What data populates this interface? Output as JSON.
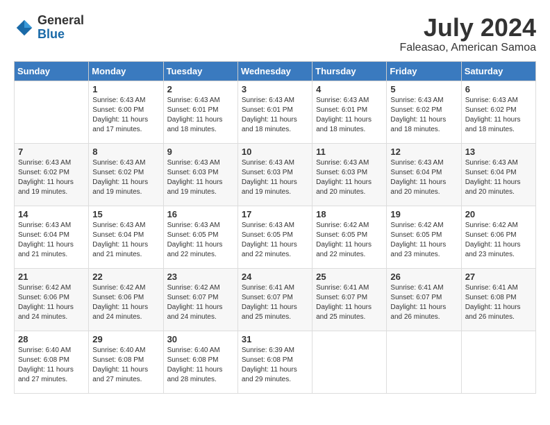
{
  "logo": {
    "general": "General",
    "blue": "Blue",
    "icon_color": "#1a6aa8"
  },
  "title": {
    "month_year": "July 2024",
    "location": "Faleasao, American Samoa"
  },
  "weekdays": [
    "Sunday",
    "Monday",
    "Tuesday",
    "Wednesday",
    "Thursday",
    "Friday",
    "Saturday"
  ],
  "weeks": [
    [
      {
        "day": "",
        "sunrise": "",
        "sunset": "",
        "daylight": ""
      },
      {
        "day": "1",
        "sunrise": "Sunrise: 6:43 AM",
        "sunset": "Sunset: 6:00 PM",
        "daylight": "Daylight: 11 hours and 17 minutes."
      },
      {
        "day": "2",
        "sunrise": "Sunrise: 6:43 AM",
        "sunset": "Sunset: 6:01 PM",
        "daylight": "Daylight: 11 hours and 18 minutes."
      },
      {
        "day": "3",
        "sunrise": "Sunrise: 6:43 AM",
        "sunset": "Sunset: 6:01 PM",
        "daylight": "Daylight: 11 hours and 18 minutes."
      },
      {
        "day": "4",
        "sunrise": "Sunrise: 6:43 AM",
        "sunset": "Sunset: 6:01 PM",
        "daylight": "Daylight: 11 hours and 18 minutes."
      },
      {
        "day": "5",
        "sunrise": "Sunrise: 6:43 AM",
        "sunset": "Sunset: 6:02 PM",
        "daylight": "Daylight: 11 hours and 18 minutes."
      },
      {
        "day": "6",
        "sunrise": "Sunrise: 6:43 AM",
        "sunset": "Sunset: 6:02 PM",
        "daylight": "Daylight: 11 hours and 18 minutes."
      }
    ],
    [
      {
        "day": "7",
        "sunrise": "Sunrise: 6:43 AM",
        "sunset": "Sunset: 6:02 PM",
        "daylight": "Daylight: 11 hours and 19 minutes."
      },
      {
        "day": "8",
        "sunrise": "Sunrise: 6:43 AM",
        "sunset": "Sunset: 6:02 PM",
        "daylight": "Daylight: 11 hours and 19 minutes."
      },
      {
        "day": "9",
        "sunrise": "Sunrise: 6:43 AM",
        "sunset": "Sunset: 6:03 PM",
        "daylight": "Daylight: 11 hours and 19 minutes."
      },
      {
        "day": "10",
        "sunrise": "Sunrise: 6:43 AM",
        "sunset": "Sunset: 6:03 PM",
        "daylight": "Daylight: 11 hours and 19 minutes."
      },
      {
        "day": "11",
        "sunrise": "Sunrise: 6:43 AM",
        "sunset": "Sunset: 6:03 PM",
        "daylight": "Daylight: 11 hours and 20 minutes."
      },
      {
        "day": "12",
        "sunrise": "Sunrise: 6:43 AM",
        "sunset": "Sunset: 6:04 PM",
        "daylight": "Daylight: 11 hours and 20 minutes."
      },
      {
        "day": "13",
        "sunrise": "Sunrise: 6:43 AM",
        "sunset": "Sunset: 6:04 PM",
        "daylight": "Daylight: 11 hours and 20 minutes."
      }
    ],
    [
      {
        "day": "14",
        "sunrise": "Sunrise: 6:43 AM",
        "sunset": "Sunset: 6:04 PM",
        "daylight": "Daylight: 11 hours and 21 minutes."
      },
      {
        "day": "15",
        "sunrise": "Sunrise: 6:43 AM",
        "sunset": "Sunset: 6:04 PM",
        "daylight": "Daylight: 11 hours and 21 minutes."
      },
      {
        "day": "16",
        "sunrise": "Sunrise: 6:43 AM",
        "sunset": "Sunset: 6:05 PM",
        "daylight": "Daylight: 11 hours and 22 minutes."
      },
      {
        "day": "17",
        "sunrise": "Sunrise: 6:43 AM",
        "sunset": "Sunset: 6:05 PM",
        "daylight": "Daylight: 11 hours and 22 minutes."
      },
      {
        "day": "18",
        "sunrise": "Sunrise: 6:42 AM",
        "sunset": "Sunset: 6:05 PM",
        "daylight": "Daylight: 11 hours and 22 minutes."
      },
      {
        "day": "19",
        "sunrise": "Sunrise: 6:42 AM",
        "sunset": "Sunset: 6:05 PM",
        "daylight": "Daylight: 11 hours and 23 minutes."
      },
      {
        "day": "20",
        "sunrise": "Sunrise: 6:42 AM",
        "sunset": "Sunset: 6:06 PM",
        "daylight": "Daylight: 11 hours and 23 minutes."
      }
    ],
    [
      {
        "day": "21",
        "sunrise": "Sunrise: 6:42 AM",
        "sunset": "Sunset: 6:06 PM",
        "daylight": "Daylight: 11 hours and 24 minutes."
      },
      {
        "day": "22",
        "sunrise": "Sunrise: 6:42 AM",
        "sunset": "Sunset: 6:06 PM",
        "daylight": "Daylight: 11 hours and 24 minutes."
      },
      {
        "day": "23",
        "sunrise": "Sunrise: 6:42 AM",
        "sunset": "Sunset: 6:07 PM",
        "daylight": "Daylight: 11 hours and 24 minutes."
      },
      {
        "day": "24",
        "sunrise": "Sunrise: 6:41 AM",
        "sunset": "Sunset: 6:07 PM",
        "daylight": "Daylight: 11 hours and 25 minutes."
      },
      {
        "day": "25",
        "sunrise": "Sunrise: 6:41 AM",
        "sunset": "Sunset: 6:07 PM",
        "daylight": "Daylight: 11 hours and 25 minutes."
      },
      {
        "day": "26",
        "sunrise": "Sunrise: 6:41 AM",
        "sunset": "Sunset: 6:07 PM",
        "daylight": "Daylight: 11 hours and 26 minutes."
      },
      {
        "day": "27",
        "sunrise": "Sunrise: 6:41 AM",
        "sunset": "Sunset: 6:08 PM",
        "daylight": "Daylight: 11 hours and 26 minutes."
      }
    ],
    [
      {
        "day": "28",
        "sunrise": "Sunrise: 6:40 AM",
        "sunset": "Sunset: 6:08 PM",
        "daylight": "Daylight: 11 hours and 27 minutes."
      },
      {
        "day": "29",
        "sunrise": "Sunrise: 6:40 AM",
        "sunset": "Sunset: 6:08 PM",
        "daylight": "Daylight: 11 hours and 27 minutes."
      },
      {
        "day": "30",
        "sunrise": "Sunrise: 6:40 AM",
        "sunset": "Sunset: 6:08 PM",
        "daylight": "Daylight: 11 hours and 28 minutes."
      },
      {
        "day": "31",
        "sunrise": "Sunrise: 6:39 AM",
        "sunset": "Sunset: 6:08 PM",
        "daylight": "Daylight: 11 hours and 29 minutes."
      },
      {
        "day": "",
        "sunrise": "",
        "sunset": "",
        "daylight": ""
      },
      {
        "day": "",
        "sunrise": "",
        "sunset": "",
        "daylight": ""
      },
      {
        "day": "",
        "sunrise": "",
        "sunset": "",
        "daylight": ""
      }
    ]
  ]
}
